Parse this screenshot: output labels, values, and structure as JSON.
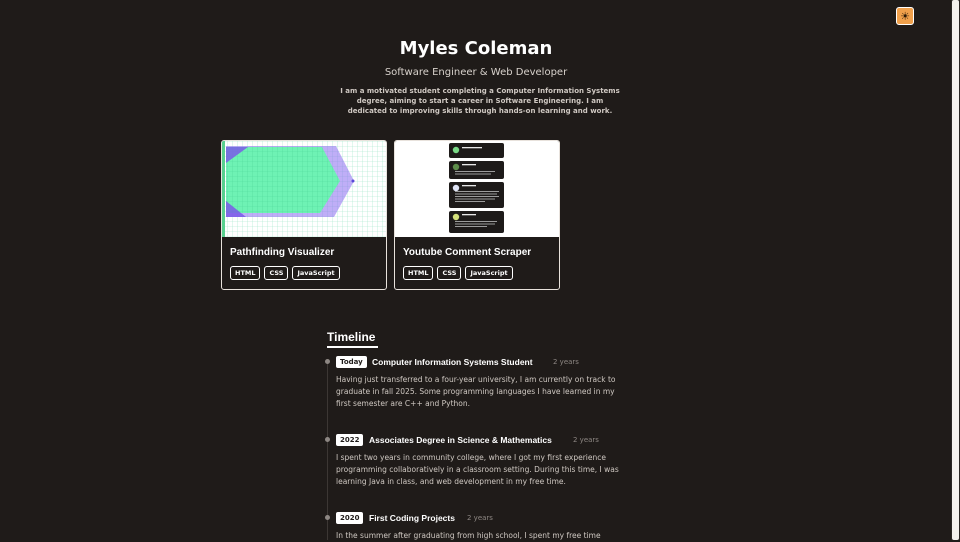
{
  "header": {
    "name": "Myles Coleman",
    "subtitle": "Software Engineer & Web Developer",
    "bio": "I am a motivated student completing a Computer Information Systems degree, aiming to start a career in Software Engineering. I am dedicated to improving skills through hands-on learning and work."
  },
  "theme_toggle": {
    "icon": "sun-icon",
    "glyph": "☀",
    "color": "#f0a04b"
  },
  "projects": [
    {
      "title": "Pathfinding Visualizer",
      "tags": [
        "HTML",
        "CSS",
        "JavaScript"
      ]
    },
    {
      "title": "Youtube Comment Scraper",
      "tags": [
        "HTML",
        "CSS",
        "JavaScript"
      ]
    }
  ],
  "timeline": {
    "heading": "Timeline",
    "entries": [
      {
        "badge": "Today",
        "title": "Computer Information Systems Student",
        "duration": "2 years",
        "description": "Having just transferred to a four-year university, I am currently on track to graduate in fall 2025. Some programming languages I have learned in my first semester are C++ and Python."
      },
      {
        "badge": "2022",
        "title": "Associates Degree in Science & Mathematics",
        "duration": "2 years",
        "description": "I spent two years in community college, where I got my first experience programming collaboratively in a classroom setting. During this time, I was learning Java in class, and web development in my free time."
      },
      {
        "badge": "2020",
        "title": "First Coding Projects",
        "duration": "2 years",
        "description": "In the summer after graduating from high school, I spent my free time"
      }
    ]
  },
  "colors": {
    "background": "#1f1b19",
    "grid_green": "#7ef0b0",
    "wall_purple": "#8a6cf0"
  }
}
